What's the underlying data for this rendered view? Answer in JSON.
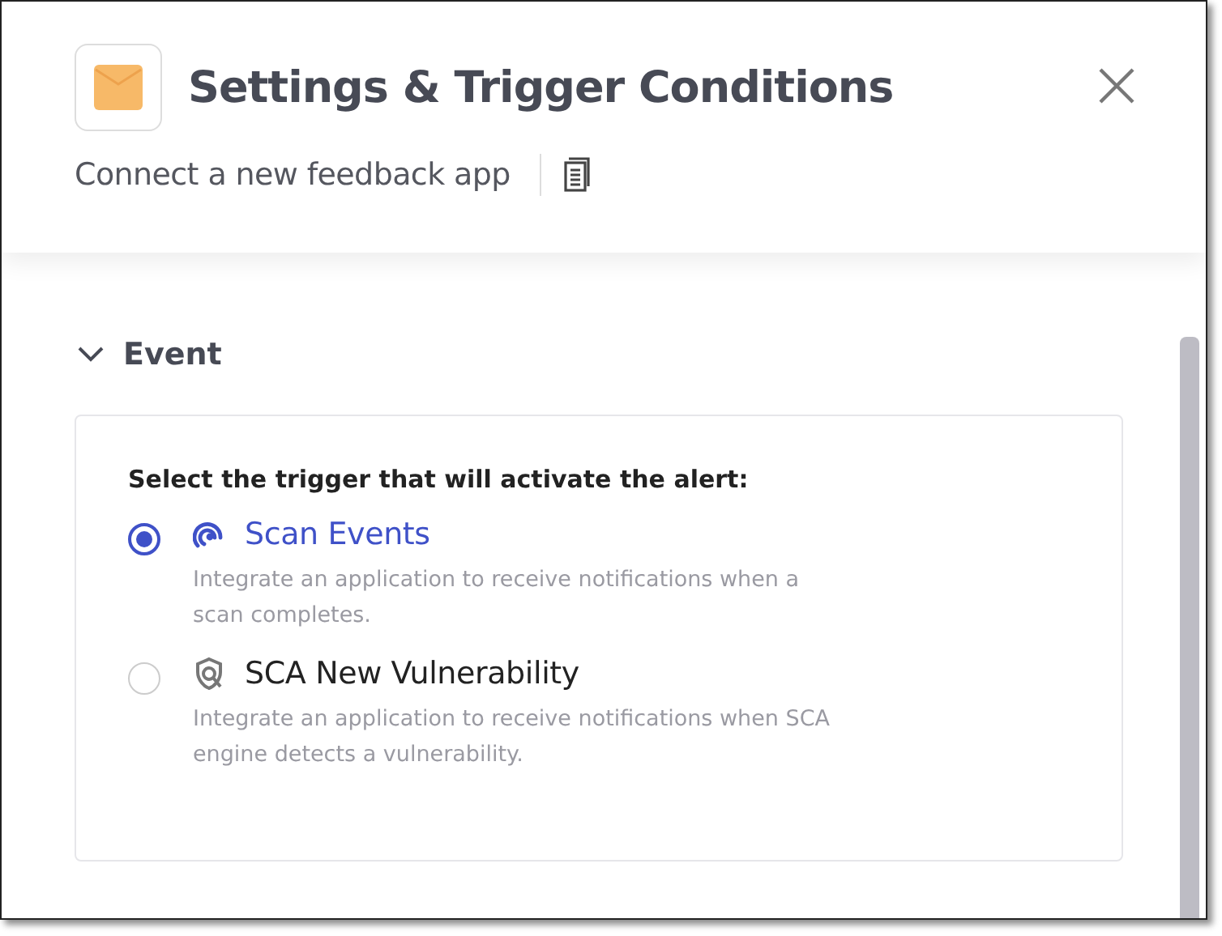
{
  "dialog": {
    "title": "Settings & Trigger Conditions",
    "subtitle": "Connect a new feedback app"
  },
  "section": {
    "title": "Event",
    "expanded": true,
    "prompt": "Select the trigger that will activate the alert:",
    "options": [
      {
        "label": "Scan Events",
        "description": "Integrate an application to receive notifications when a scan completes.",
        "selected": true
      },
      {
        "label": "SCA New Vulnerability",
        "description": "Integrate an application to receive notifications when SCA engine detects a vulnerability.",
        "selected": false
      }
    ]
  }
}
